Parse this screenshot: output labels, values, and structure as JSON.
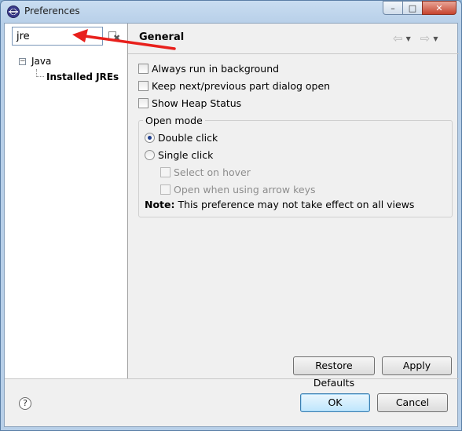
{
  "window": {
    "title": "Preferences",
    "controls": {
      "minimize": "–",
      "maximize": "□",
      "close": "✕"
    }
  },
  "filter": {
    "value": "jre"
  },
  "tree": {
    "items": [
      {
        "label": "Java",
        "expander": "−"
      },
      {
        "label": "Installed JREs"
      }
    ]
  },
  "page": {
    "title": "General",
    "nav": {
      "back": "⇦",
      "forward": "⇨",
      "dropdown": "▼"
    }
  },
  "options": {
    "always_run_background": {
      "label": "Always run in background",
      "checked": false
    },
    "keep_dialog_open": {
      "label": "Keep next/previous part dialog open",
      "checked": false
    },
    "show_heap_status": {
      "label": "Show Heap Status",
      "checked": false
    }
  },
  "open_mode": {
    "legend": "Open mode",
    "double_click": {
      "label": "Double click",
      "selected": true
    },
    "single_click": {
      "label": "Single click",
      "selected": false
    },
    "select_on_hover": {
      "label": "Select on hover",
      "enabled": false
    },
    "open_arrow_keys": {
      "label": "Open when using arrow keys",
      "enabled": false
    },
    "note_label": "Note:",
    "note_text": "This preference may not take effect on all views"
  },
  "buttons": {
    "restore_defaults": "Restore Defaults",
    "apply": "Apply",
    "ok": "OK",
    "cancel": "Cancel"
  },
  "help": {
    "glyph": "?"
  },
  "colors": {
    "annotation_arrow": "#e8201c"
  }
}
